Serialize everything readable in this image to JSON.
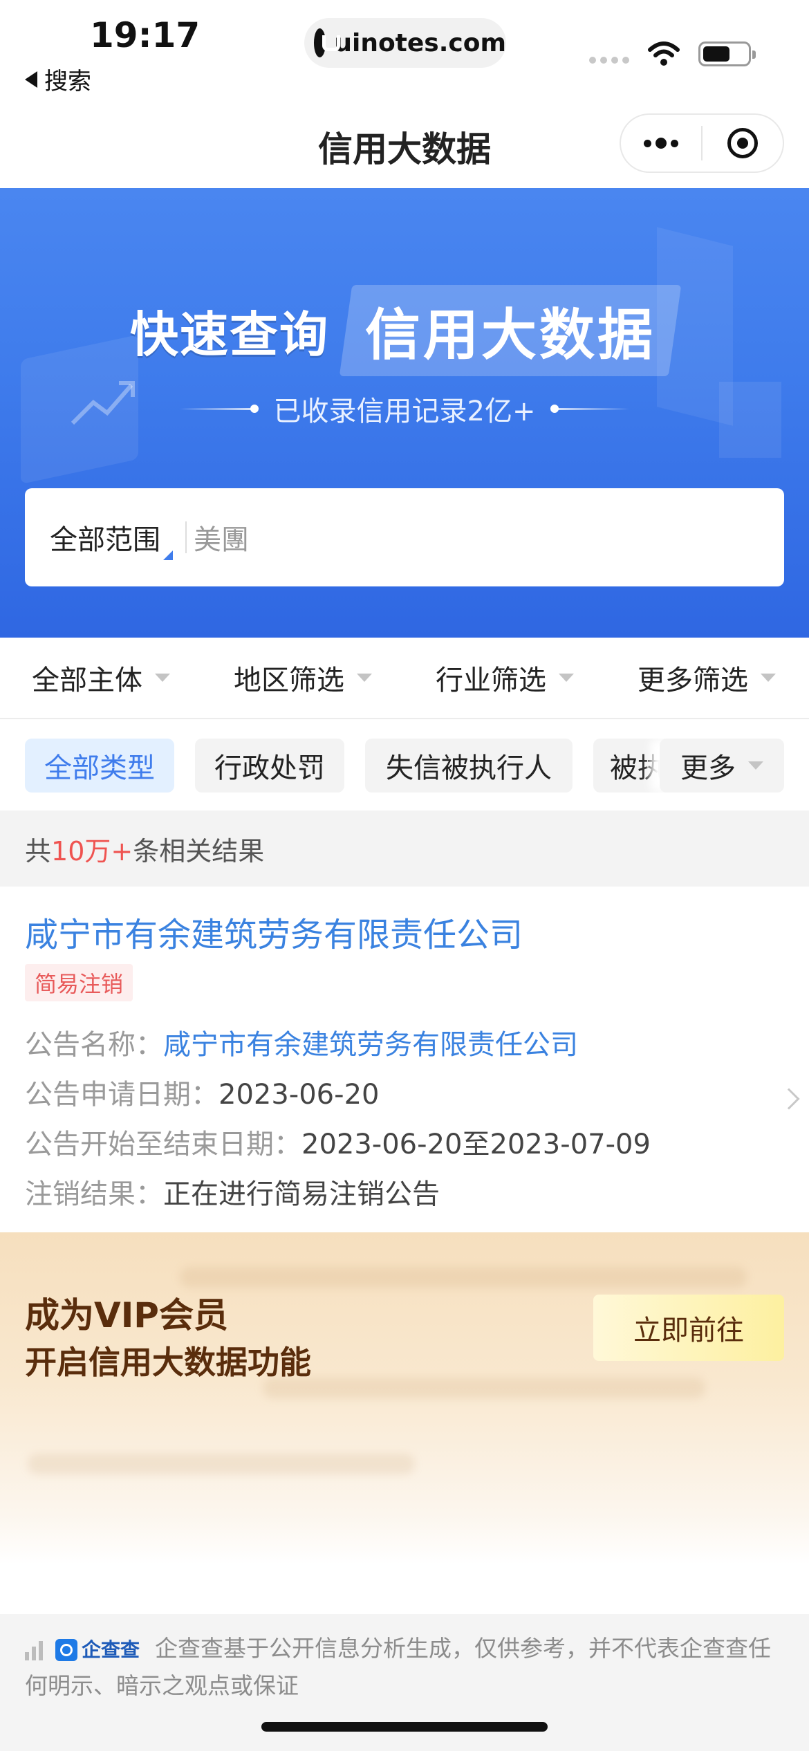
{
  "status_bar": {
    "time": "19:17",
    "back_label": "搜索",
    "url": "uinotes.com"
  },
  "nav": {
    "title": "信用大数据"
  },
  "hero": {
    "headline_left": "快速查询",
    "headline_right": "信用大数据",
    "subline": "已收录信用记录2亿+"
  },
  "search": {
    "scope": "全部范围",
    "value": "美團"
  },
  "filters": [
    {
      "label": "全部主体"
    },
    {
      "label": "地区筛选"
    },
    {
      "label": "行业筛选"
    },
    {
      "label": "更多筛选"
    }
  ],
  "chips": [
    {
      "label": "全部类型",
      "active": true
    },
    {
      "label": "行政处罚",
      "active": false
    },
    {
      "label": "失信被执行人",
      "active": false
    },
    {
      "label": "被执",
      "active": false
    }
  ],
  "chips_more": "更多",
  "results": {
    "prefix": "共",
    "count": "10万+",
    "suffix": "条相关结果"
  },
  "card": {
    "company": "咸宁市有余建筑劳务有限责任公司",
    "tag": "简易注销",
    "rows": [
      {
        "label": "公告名称：",
        "value": "咸宁市有余建筑劳务有限责任公司"
      },
      {
        "label": "公告申请日期：",
        "value": "2023-06-20"
      },
      {
        "label": "公告开始至结束日期：",
        "value": "2023-06-20至2023-07-09"
      },
      {
        "label": "注销结果：",
        "value": "正在进行简易注销公告"
      }
    ]
  },
  "vip": {
    "line1": "成为VIP会员",
    "line2": "开启信用大数据功能",
    "button": "立即前往"
  },
  "footer": {
    "brand": "企查查",
    "disclaimer": "企查查基于公开信息分析生成，仅供参考，并不代表企查查任何明示、暗示之观点或保证"
  },
  "colors": {
    "primary": "#3f7cec",
    "link": "#3a82e0",
    "highlight": "#ef5350",
    "vip_text": "#5a2d0c"
  }
}
